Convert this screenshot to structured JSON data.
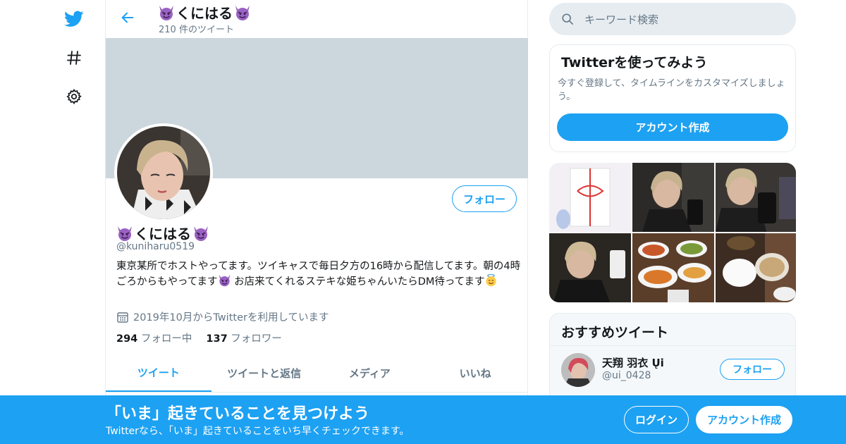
{
  "colors": {
    "accent": "#1da1f2",
    "banner": "#ccd6dd",
    "muted": "#657786",
    "border": "#e6ecf0"
  },
  "nav": {
    "icons": [
      "twitter-bird-icon",
      "hashtag-icon",
      "gear-icon"
    ]
  },
  "header": {
    "name": "くにはる",
    "tweet_count": "210 件のツイート"
  },
  "profile": {
    "name": "くにはる",
    "handle": "@kuniharu0519",
    "follow_label": "フォロー",
    "bio_1": "東京某所でホストやってます。ツイキャスで毎日夕方の16時から配信してます。朝の4時ごろからもやってます",
    "bio_2": " お店来てくれるステキな姫ちゃんいたらDM待ってます",
    "joined": "2019年10月からTwitterを利用しています",
    "following_count": "294",
    "following_label": "フォロー中",
    "followers_count": "137",
    "followers_label": "フォロワー"
  },
  "tabs": [
    {
      "label": "ツイート",
      "active": true
    },
    {
      "label": "ツイートと返信",
      "active": false
    },
    {
      "label": "メディア",
      "active": false
    },
    {
      "label": "いいね",
      "active": false
    }
  ],
  "search": {
    "placeholder": "キーワード検索"
  },
  "try_card": {
    "title": "Twitterを使ってみよう",
    "description": "今すぐ登録して、タイムラインをカスタマイズしましょう。",
    "button": "アカウント作成"
  },
  "recommended": {
    "title": "おすすめツイート",
    "name": "天翔 羽衣 Ųi",
    "handle": "@ui_0428",
    "follow_label": "フォロー"
  },
  "bottom_bar": {
    "title": "「いま」起きていることを見つけよう",
    "subtitle": "Twitterなら、「いま」起きていることをいち早くチェックできます。",
    "login": "ログイン",
    "signup": "アカウント作成"
  }
}
